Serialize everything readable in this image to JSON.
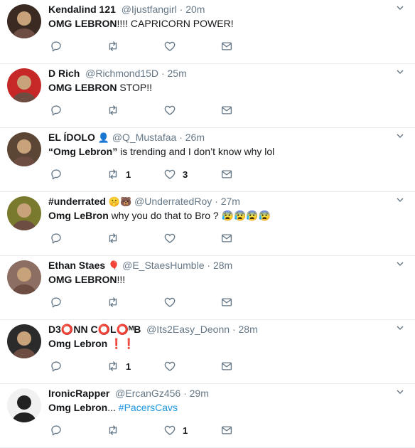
{
  "tweets": [
    {
      "name": "Kendalind 121",
      "name_emoji": "",
      "handle": "@Ijustfangirl",
      "time": "20m",
      "text_bold": "OMG LEBRON",
      "text_rest": "!!!! CAPRICORN POWER!",
      "hashtag": "",
      "retweets": "",
      "likes": "",
      "avatar_color": "#3b2a22"
    },
    {
      "name": "D Rich",
      "name_emoji": "",
      "handle": "@Richmond15D",
      "time": "25m",
      "text_bold": "OMG LEBRON",
      "text_rest": " STOP!!",
      "hashtag": "",
      "retweets": "",
      "likes": "",
      "avatar_color": "#c62828"
    },
    {
      "name": "EL ÍDOLO",
      "name_emoji": "👤",
      "handle": "@Q_Mustafaa",
      "time": "26m",
      "text_bold": "“Omg Lebron”",
      "text_rest": " is trending and I don’t know why lol",
      "hashtag": "",
      "retweets": "1",
      "likes": "3",
      "avatar_color": "#5b4636"
    },
    {
      "name": "#underrated",
      "name_emoji": "🤫🐻",
      "handle": "@UnderratedRoy",
      "time": "27m",
      "text_bold": "Omg LeBron",
      "text_rest": " why you do that to Bro ? 😰😰😰😰",
      "hashtag": "",
      "retweets": "",
      "likes": "",
      "avatar_color": "#7a7a2e"
    },
    {
      "name": "Ethan Staes",
      "name_emoji": "🎈",
      "handle": "@E_StaesHumble",
      "time": "28m",
      "text_bold": "OMG LEBRON",
      "text_rest": "!!!",
      "hashtag": "",
      "retweets": "",
      "likes": "",
      "avatar_color": "#8d6e63"
    },
    {
      "name": "D3⭕NN C⭕L⭕ᴹB",
      "name_emoji": "",
      "handle": "@Its2Easy_Deonn",
      "time": "28m",
      "text_bold": "Omg Lebron",
      "text_rest": " ❗❗",
      "hashtag": "",
      "retweets": "1",
      "likes": "",
      "avatar_color": "#2b2b2b"
    },
    {
      "name": "IronicRapper",
      "name_emoji": "",
      "handle": "@ErcanGz456",
      "time": "29m",
      "text_bold": "Omg Lebron",
      "text_rest": "... ",
      "hashtag": "#PacersCavs",
      "retweets": "",
      "likes": "1",
      "avatar_color": "#f1f1f1"
    }
  ],
  "icons": {
    "reply": "reply-icon",
    "retweet": "retweet-icon",
    "like": "heart-icon",
    "dm": "envelope-icon",
    "menu": "chevron-down-icon"
  },
  "colors": {
    "text": "#14171a",
    "muted": "#657786",
    "link": "#1b95e0",
    "divider": "#e6ecf0"
  }
}
